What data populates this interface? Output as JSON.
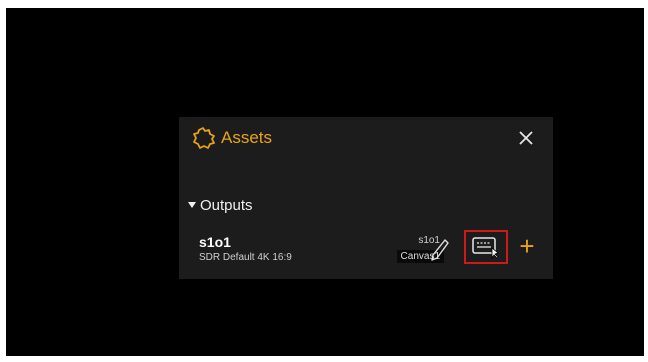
{
  "panel": {
    "title": "Assets",
    "title_icon": "assets-icon",
    "close_icon": "close-icon",
    "accent_color": "#e8a31a",
    "highlight_color": "#d01818"
  },
  "outputs": {
    "section_label": "Outputs",
    "expanded": true,
    "items": [
      {
        "name": "s1o1",
        "format": "SDR  Default 4K 16:9",
        "source": "s1o1",
        "canvas": "Canvas1",
        "actions": [
          "pencil-icon",
          "output-config-icon",
          "add-icon"
        ]
      }
    ],
    "add_label": "+"
  }
}
